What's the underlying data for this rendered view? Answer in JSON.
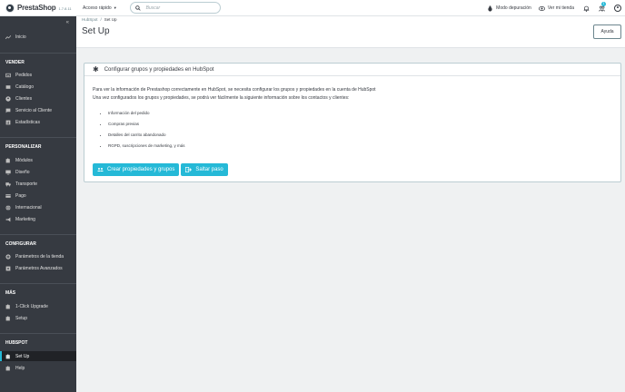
{
  "header": {
    "logo_text": "PrestaShop",
    "version": "1.7.8.11",
    "quick_access": "Acceso rápido",
    "search_placeholder": "Buscar",
    "debug_mode": "Modo depuración",
    "view_store": "Ver mi tienda",
    "notifications_badge": "1"
  },
  "sidebar": {
    "collapse_icon": "«",
    "home": "Inicio",
    "sections": {
      "vender": "VENDER",
      "personalizar": "PERSONALIZAR",
      "configurar": "CONFIGURAR",
      "mas": "MÁS",
      "hubspot": "HUBSPOT"
    },
    "vender_items": [
      "Pedidos",
      "Catálogo",
      "Clientes",
      "Servicio al Cliente",
      "Estadísticas"
    ],
    "personalizar_items": [
      "Módulos",
      "Diseño",
      "Transporte",
      "Pago",
      "Internacional",
      "Marketing"
    ],
    "configurar_items": [
      "Parámetros de la tienda",
      "Parámetros Avanzados"
    ],
    "mas_items": [
      "1-Click Upgrade",
      "Setup"
    ],
    "hubspot_items": [
      "Set Up",
      "Help"
    ]
  },
  "page": {
    "breadcrumb_parent": "HubSpot",
    "breadcrumb_sep": "/",
    "breadcrumb_current": "Set Up",
    "title": "Set Up",
    "help_button": "Ayuda"
  },
  "panel": {
    "header_icon": "✱",
    "title": "Configurar grupos y propiedades en HubSpot",
    "intro_line1": "Para ver la información de Prestashop correctamente en HubSpot, se necesita configurar los grupos y propiedades en la cuenta de HubSpot",
    "intro_line2": "Una vez configurados los grupos y propiedades, se podrá ver fácilmente la siguiente información sobre los contactos y clientes:",
    "list": [
      "Información del pedido",
      "Compras previas",
      "Detalles del carrito abandonado",
      "RGPD, suscripciones de marketing, y más"
    ],
    "create_button": "Crear propiedades y grupos",
    "skip_button": "Saltar paso"
  },
  "colors": {
    "accent": "#25b9d7",
    "sidebar_bg": "#363a41",
    "sidebar_active": "#202226"
  }
}
